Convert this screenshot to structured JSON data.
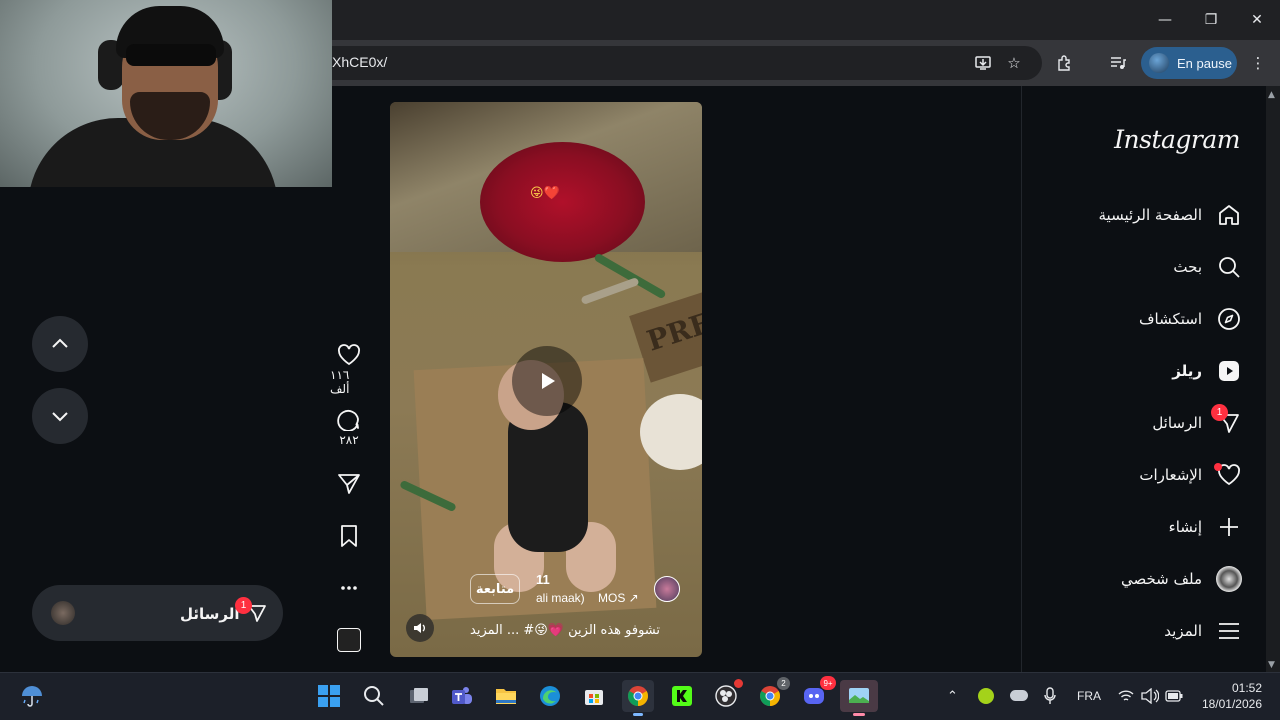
{
  "browser": {
    "url_fragment": "XhCE0x/",
    "profile_status": "En pause",
    "window_controls": [
      "minimize-icon",
      "restore-icon",
      "close-icon"
    ],
    "toolbar_icons": [
      "install-app-icon",
      "bookmark-star-icon",
      "extensions-icon",
      "media-controls-icon",
      "more-menu-icon"
    ]
  },
  "left_panel": {
    "up_button_icon": "chevron-up-icon",
    "down_button_icon": "chevron-down-icon",
    "messages_float_label": "الرسائل",
    "messages_badge": "1"
  },
  "reel": {
    "follow_label": "متابعة",
    "count_label": "11",
    "audio_text": "ali maak)",
    "author_text": "MOS ↗",
    "caption": "تشوفو هذه الزين 💗😜# ... المزيد",
    "sign_text": "PRE",
    "overlay_emoji": "😜❤️"
  },
  "actions": {
    "likes": "١١٦ ألف",
    "comments": "٢٨٢"
  },
  "sidebar": {
    "logo": "Instagram",
    "items": [
      {
        "label": "الصفحة الرئيسية",
        "icon": "home-icon"
      },
      {
        "label": "بحث",
        "icon": "search-icon"
      },
      {
        "label": "استكشاف",
        "icon": "compass-icon"
      },
      {
        "label": "ريلز",
        "icon": "reels-icon"
      },
      {
        "label": "الرسائل",
        "icon": "messenger-icon",
        "badge": "1"
      },
      {
        "label": "الإشعارات",
        "icon": "heart-icon"
      },
      {
        "label": "إنشاء",
        "icon": "plus-icon"
      },
      {
        "label": "ملف شخصي",
        "icon": "profile-avatar-icon"
      },
      {
        "label": "المزيد",
        "icon": "menu-icon"
      }
    ]
  },
  "taskbar": {
    "apps": [
      "start-icon",
      "search-icon",
      "task-view-icon",
      "teams-icon",
      "file-explorer-icon",
      "edge-icon",
      "store-icon",
      "chrome-icon",
      "kick-icon",
      "obs-icon",
      "chrome-profile-icon",
      "discord-icon",
      "photos-icon"
    ],
    "discord_badge": "9+",
    "chrome_badge": "2",
    "language": "FRA",
    "time": "01:52",
    "date": "18/01/2026"
  },
  "colors": {
    "background": "#0c0f13",
    "accent_blue": "#2b5f8f",
    "notification_red": "#ff3040"
  }
}
